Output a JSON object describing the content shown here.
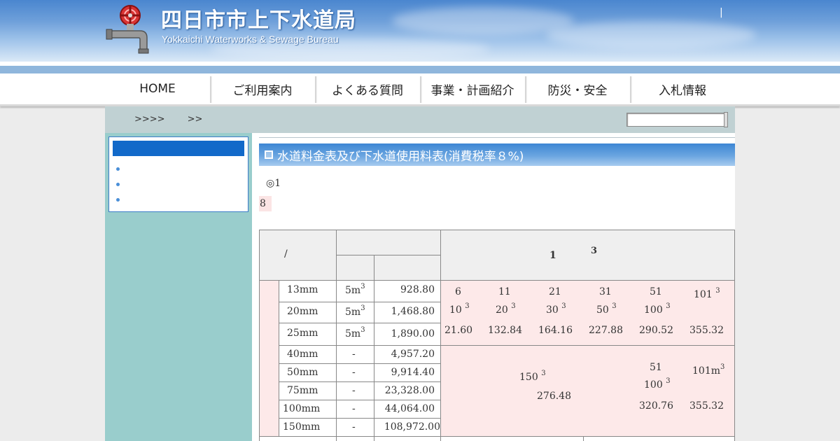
{
  "header": {
    "title": "四日市市上下水道局",
    "subtitle": "Yokkaichi Waterworks & Sewage Bureau",
    "separator": "|"
  },
  "nav": {
    "items": [
      {
        "label": "HOME"
      },
      {
        "label": "ご利用案内"
      },
      {
        "label": "よくある質問"
      },
      {
        "label": "事業・計画紹介"
      },
      {
        "label": "防災・安全"
      },
      {
        "label": "入札情報"
      }
    ]
  },
  "breadcrumb": {
    "text1": ">>>>",
    "text2": ">>"
  },
  "main": {
    "section_title": "水道料金表及び下水道使用料表(消費税率８%)",
    "note1": "◎1",
    "note2": "8"
  },
  "table": {
    "header": {
      "slash": "/",
      "one": "1",
      "three": "3"
    },
    "rows_small": [
      {
        "size": "13mm",
        "base": "5m",
        "price": "928.80"
      },
      {
        "size": "20mm",
        "base": "5m",
        "price": "1,468.80"
      },
      {
        "size": "25mm",
        "base": "5m",
        "price": "1,890.00"
      }
    ],
    "tiers_top": [
      "6",
      "11",
      "21",
      "31",
      "51"
    ],
    "tier_last": "101",
    "tiers_mid": [
      "10",
      "20",
      "30",
      "50",
      "100"
    ],
    "tier_prices": [
      "21.60",
      "132.84",
      "164.16",
      "227.88",
      "290.52",
      "355.32"
    ],
    "rows_large": [
      {
        "size": "40mm",
        "base": "-",
        "price": "4,957.20"
      },
      {
        "size": "50mm",
        "base": "-",
        "price": "9,914.40"
      },
      {
        "size": "75mm",
        "base": "-",
        "price": "23,328.00"
      },
      {
        "size": "100mm",
        "base": "-",
        "price": "44,064.00"
      },
      {
        "size": "150mm",
        "base": "-",
        "price": "108,972.00"
      }
    ],
    "large_tier1_a": "150",
    "large_tier1_price": "276.48",
    "large_tier2_a": "51",
    "large_tier2_b": "100",
    "large_tier2_price": "320.76",
    "large_tier3_a": "101m",
    "large_tier3_price": "355.32",
    "sup3": "3"
  }
}
